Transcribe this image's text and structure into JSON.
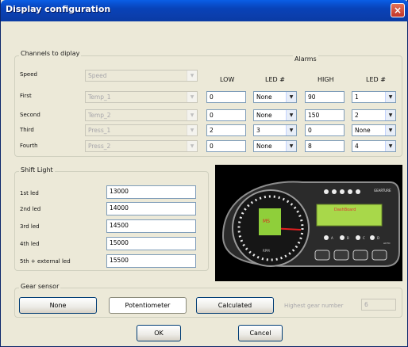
{
  "window": {
    "title": "Display configuration",
    "close_glyph": "×"
  },
  "channels": {
    "group_label": "Channels to diplay",
    "alarms_label": "Alarms",
    "headers": {
      "low": "LOW",
      "led1": "LED #",
      "high": "HIGH",
      "led2": "LED #"
    },
    "rows": [
      {
        "label": "Speed",
        "channel": "Speed",
        "low": "",
        "led1": "",
        "high": "",
        "led2": ""
      },
      {
        "label": "First",
        "channel": "Temp_1",
        "low": "0",
        "led1": "None",
        "high": "90",
        "led2": "1"
      },
      {
        "label": "Second",
        "channel": "Temp_2",
        "low": "0",
        "led1": "None",
        "high": "150",
        "led2": "2"
      },
      {
        "label": "Third",
        "channel": "Press_1",
        "low": "2",
        "led1": "3",
        "high": "0",
        "led2": "None"
      },
      {
        "label": "Fourth",
        "channel": "Press_2",
        "low": "0",
        "led1": "None",
        "high": "8",
        "led2": "4"
      }
    ]
  },
  "shift_light": {
    "group_label": "Shift Light",
    "leds": [
      {
        "label": "1st led",
        "value": "13000"
      },
      {
        "label": "2nd led",
        "value": "14000"
      },
      {
        "label": "3rd led",
        "value": "14500"
      },
      {
        "label": "4th led",
        "value": "15000"
      },
      {
        "label": "5th + external led",
        "value": "15500"
      }
    ]
  },
  "dash_image": {
    "brand": "GEARTURE",
    "model": "DashBoard",
    "center_label": "MS",
    "unit_label": "RPM",
    "gear_labels": [
      "A",
      "B",
      "C",
      "D"
    ],
    "gear_sub": "AUTO"
  },
  "gear_sensor": {
    "group_label": "Gear sensor",
    "buttons": {
      "none": "None",
      "potentiometer": "Potentiometer",
      "calculated": "Calculated"
    },
    "highest_label": "Highest gear number",
    "highest_value": "6"
  },
  "footer": {
    "ok": "OK",
    "cancel": "Cancel"
  },
  "colors": {
    "title_bar": "#0a5ee6",
    "lcd_green": "#a8d84a",
    "needle_red": "#e02020"
  }
}
